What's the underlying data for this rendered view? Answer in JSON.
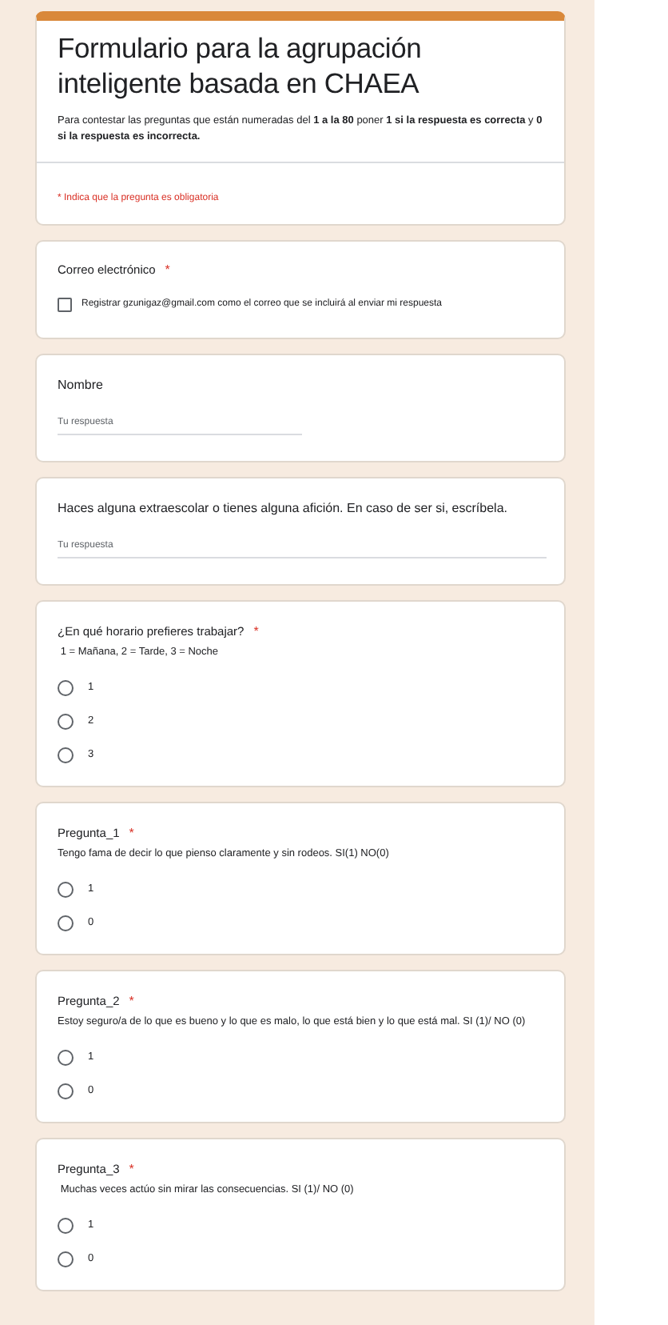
{
  "form": {
    "title": "Formulario para la agrupación inteligente basada en CHAEA",
    "description": "Para contestar las preguntas que están numeradas del **1 a la  80** poner **1 si la respuesta es correcta** y **0 si la respuesta es incorrecta.**",
    "required_note": "* Indica que la pregunta es obligatoria",
    "required_symbol": "*"
  },
  "questions": [
    {
      "kind": "email",
      "title": "Correo electrónico",
      "required": true,
      "checkbox": {
        "label": "Registrar gzunigaz@gmail.com como el correo que se incluirá al enviar mi respuesta",
        "checked": false
      }
    },
    {
      "kind": "short_text",
      "title": "Nombre",
      "required": false,
      "placeholder": "Tu respuesta",
      "wide": false
    },
    {
      "kind": "short_text",
      "title": "Haces alguna  extraescolar  o tienes alguna afición. En caso de ser si, escríbela.",
      "required": false,
      "placeholder": "Tu respuesta",
      "wide": true
    },
    {
      "kind": "choice",
      "title": "¿En qué horario prefieres trabajar?",
      "required": true,
      "description": " 1 = Mañana, 2 = Tarde, 3 = Noche",
      "options": [
        {
          "label": "1",
          "selected": false
        },
        {
          "label": "2",
          "selected": false
        },
        {
          "label": "3",
          "selected": false
        }
      ]
    },
    {
      "kind": "choice",
      "title": "Pregunta_1",
      "required": true,
      "description": "Tengo fama de decir lo que pienso claramente y sin rodeos. SI(1) NO(0)",
      "options": [
        {
          "label": "1",
          "selected": false
        },
        {
          "label": "0",
          "selected": false
        }
      ]
    },
    {
      "kind": "choice",
      "title": "Pregunta_2",
      "required": true,
      "description": "Estoy seguro/a de lo que es bueno y lo que es malo, lo que está bien y lo que está mal. SI (1)/ NO (0)",
      "options": [
        {
          "label": "1",
          "selected": false
        },
        {
          "label": "0",
          "selected": false
        }
      ]
    },
    {
      "kind": "choice",
      "title": "Pregunta_3",
      "required": true,
      "description": " Muchas veces actúo sin mirar las consecuencias. SI (1)/ NO (0)",
      "options": [
        {
          "label": "1",
          "selected": false
        },
        {
          "label": "0",
          "selected": false
        }
      ]
    }
  ]
}
